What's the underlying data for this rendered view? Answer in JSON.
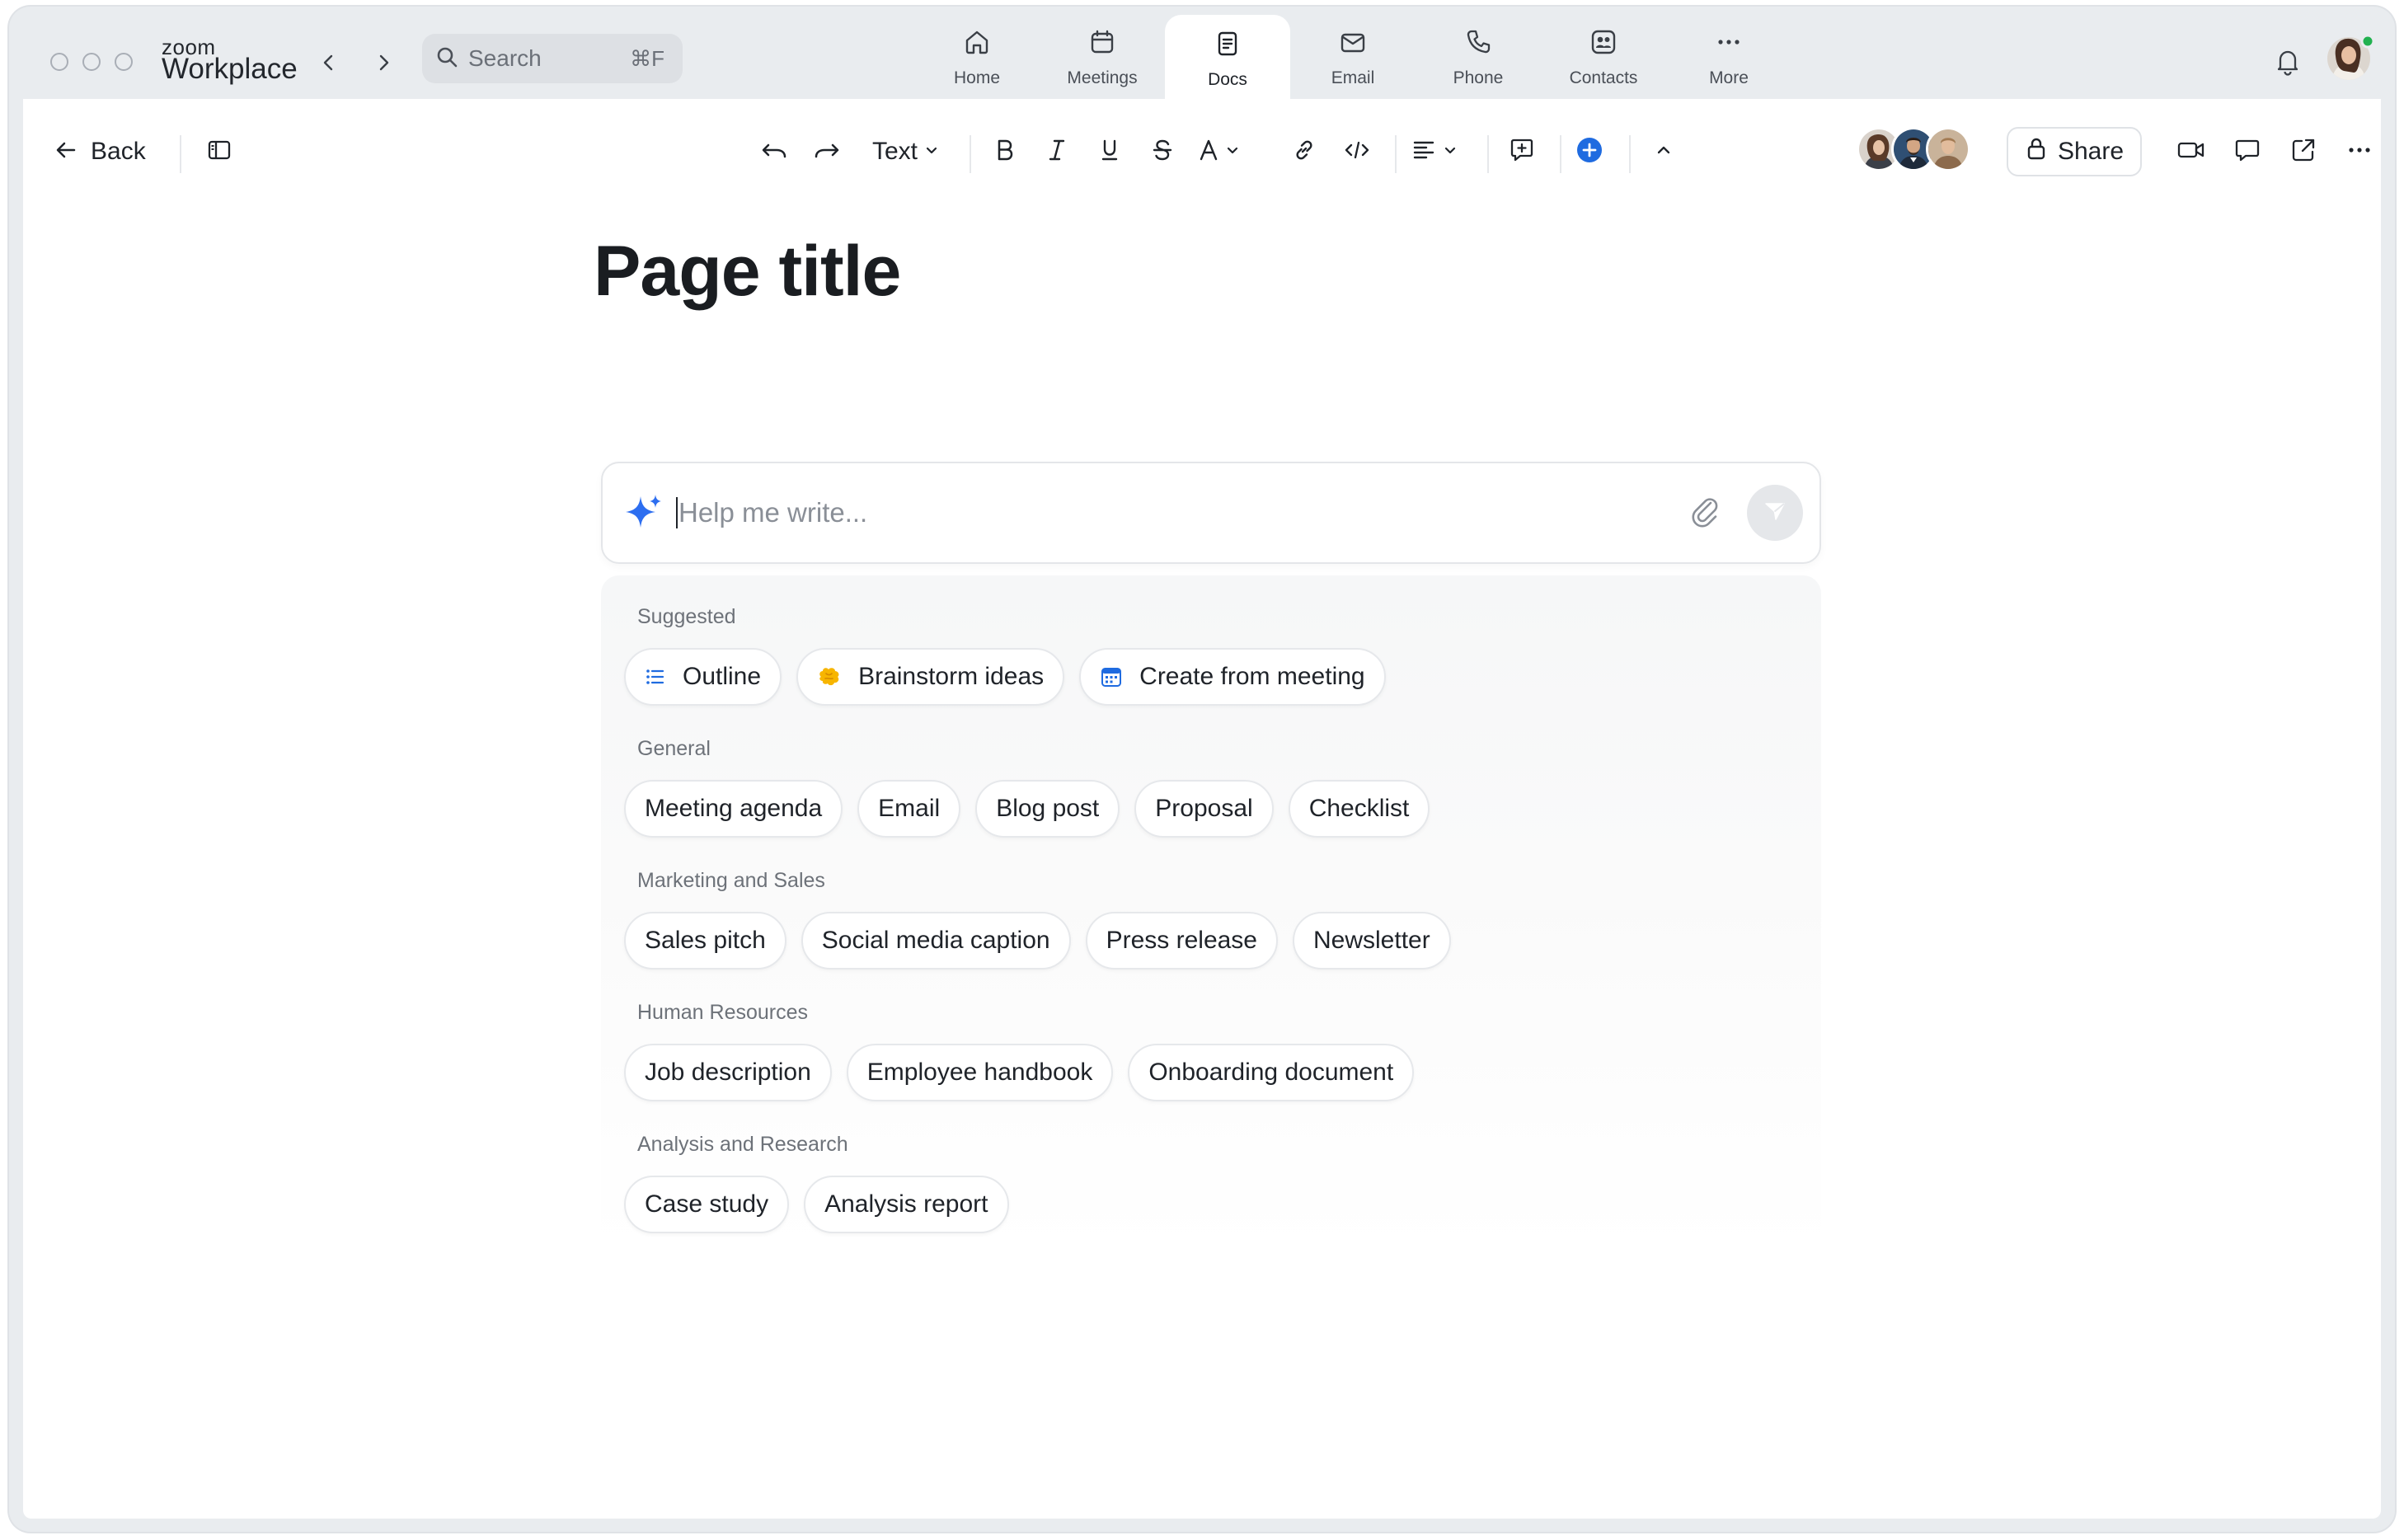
{
  "app": {
    "brand_small": "zoom",
    "brand_big": "Workplace"
  },
  "search": {
    "placeholder": "Search",
    "shortcut": "⌘F"
  },
  "tabs": [
    {
      "label": "Home",
      "icon": "home-icon"
    },
    {
      "label": "Meetings",
      "icon": "calendar-icon"
    },
    {
      "label": "Docs",
      "icon": "document-icon",
      "active": true
    },
    {
      "label": "Email",
      "icon": "mail-icon"
    },
    {
      "label": "Phone",
      "icon": "phone-icon"
    },
    {
      "label": "Contacts",
      "icon": "contacts-icon"
    },
    {
      "label": "More",
      "icon": "more-horizontal-icon"
    }
  ],
  "toolbar": {
    "back_label": "Back",
    "text_style": "Text",
    "share_label": "Share"
  },
  "document": {
    "title": "Page title",
    "ai_placeholder": "Help me write..."
  },
  "suggestions": {
    "sections": [
      {
        "label": "Suggested",
        "chips": [
          "Outline",
          "Brainstorm ideas",
          "Create from meeting"
        ]
      },
      {
        "label": "General",
        "chips": [
          "Meeting agenda",
          "Email",
          "Blog post",
          "Proposal",
          "Checklist"
        ]
      },
      {
        "label": "Marketing and Sales",
        "chips": [
          "Sales pitch",
          "Social media caption",
          "Press release",
          "Newsletter"
        ]
      },
      {
        "label": "Human Resources",
        "chips": [
          "Job description",
          "Employee handbook",
          "Onboarding document"
        ]
      },
      {
        "label": "Analysis and Research",
        "chips": [
          "Case study",
          "Analysis report"
        ]
      }
    ]
  },
  "colors": {
    "accent_blue": "#1f6be0",
    "ai_sparkle": "#2d6ef0",
    "presence_green": "#21b14f",
    "window_bg": "#e9ecef"
  }
}
